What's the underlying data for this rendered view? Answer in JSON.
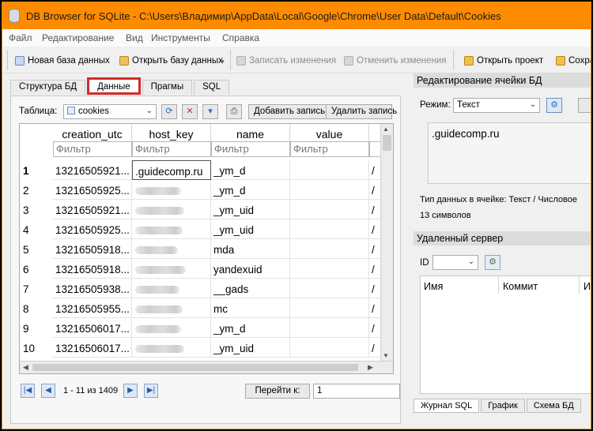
{
  "window": {
    "title": "DB Browser for SQLite - C:\\Users\\Владимир\\AppData\\Local\\Google\\Chrome\\User Data\\Default\\Cookies"
  },
  "menu": [
    "Файл",
    "Редактирование",
    "Вид",
    "Инструменты",
    "Справка"
  ],
  "toolbar": {
    "new_db": "Новая база данных",
    "open_db": "Открыть базу данных",
    "write_changes": "Записать изменения",
    "revert_changes": "Отменить изменения",
    "open_project": "Открыть проект",
    "save_trunc": "Сохра"
  },
  "tabs": [
    "Структура БД",
    "Данные",
    "Прагмы",
    "SQL"
  ],
  "active_tab": "Данные",
  "table_selector": {
    "label": "Таблица:",
    "value": "cookies"
  },
  "buttons": {
    "add_record": "Добавить запись",
    "delete_record": "Удалить запись"
  },
  "grid": {
    "columns": [
      "creation_utc",
      "host_key",
      "name",
      "value"
    ],
    "filter_placeholder": "Фильтр",
    "rows": [
      {
        "num": "1",
        "creation_utc": "13216505921...",
        "host_key": ".guidecomp.ru",
        "name": "_ym_d",
        "value": "",
        "extra": "/"
      },
      {
        "num": "2",
        "creation_utc": "13216505925...",
        "host_key": "",
        "name": "_ym_d",
        "value": "",
        "extra": "/"
      },
      {
        "num": "3",
        "creation_utc": "13216505921...",
        "host_key": "",
        "name": "_ym_uid",
        "value": "",
        "extra": "/"
      },
      {
        "num": "4",
        "creation_utc": "13216505925...",
        "host_key": "",
        "name": "_ym_uid",
        "value": "",
        "extra": "/"
      },
      {
        "num": "5",
        "creation_utc": "13216505918...",
        "host_key": "",
        "name": "mda",
        "value": "",
        "extra": "/"
      },
      {
        "num": "6",
        "creation_utc": "13216505918...",
        "host_key": "",
        "name": "yandexuid",
        "value": "",
        "extra": "/"
      },
      {
        "num": "7",
        "creation_utc": "13216505938...",
        "host_key": "",
        "name": "__gads",
        "value": "",
        "extra": "/"
      },
      {
        "num": "8",
        "creation_utc": "13216505955...",
        "host_key": "",
        "name": "mc",
        "value": "",
        "extra": "/"
      },
      {
        "num": "9",
        "creation_utc": "13216506017...",
        "host_key": "",
        "name": "_ym_d",
        "value": "",
        "extra": "/"
      },
      {
        "num": "10",
        "creation_utc": "13216506017...",
        "host_key": "",
        "name": "_ym_uid",
        "value": "",
        "extra": "/"
      }
    ]
  },
  "navigation": {
    "status": "1 - 11 из 1409",
    "goto_label": "Перейти к:",
    "goto_value": "1"
  },
  "cell_editor": {
    "header": "Редактирование ячейки БД",
    "mode_label": "Режим:",
    "mode_value": "Текст",
    "content": ".guidecomp.ru",
    "type_info": "Тип данных в ячейке: Текст / Числовое",
    "size_info": "13 символов"
  },
  "remote": {
    "header": "Удаленный сервер",
    "id_label": "ID",
    "columns": [
      "Имя",
      "Коммит",
      "И"
    ]
  },
  "bottom_tabs": [
    "Журнал SQL",
    "График",
    "Схема БД"
  ]
}
